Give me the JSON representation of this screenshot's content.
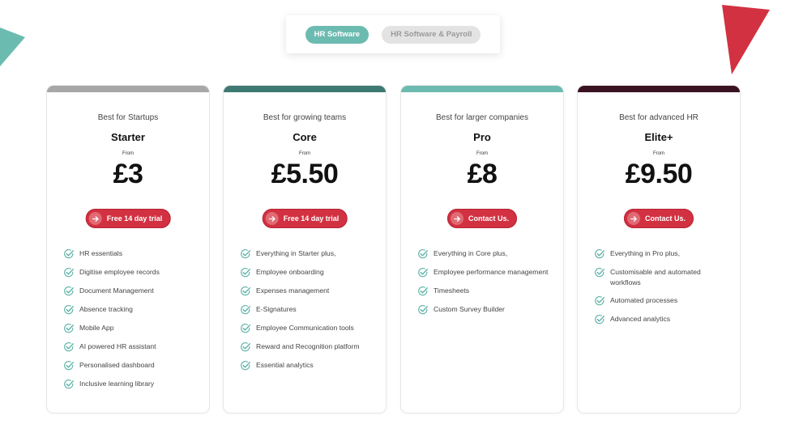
{
  "colors": {
    "teal_light": "#6cbbb1",
    "teal_dark": "#3e7a73",
    "grey_bar": "#a7a7a7",
    "maroon": "#3a1222",
    "red": "#d23141",
    "deco_red": "#d23141",
    "check": "#5bb1a7"
  },
  "toggle": {
    "options": [
      "HR Software",
      "HR Software & Payroll"
    ],
    "selected": "HR Software"
  },
  "plans": [
    {
      "subtitle": "Best for Startups",
      "name": "Starter",
      "from_label": "From",
      "price": "£3",
      "cta": "Free 14 day trial",
      "bar_color": "#a7a7a7",
      "features": [
        "HR essentials",
        "Digitise employee records",
        "Document Management",
        "Absence tracking",
        "Mobile App",
        "AI powered HR assistant",
        "Personalised dashboard",
        "Inclusive learning library"
      ]
    },
    {
      "subtitle": "Best for growing teams",
      "name": "Core",
      "from_label": "From",
      "price": "£5.50",
      "cta": "Free 14 day trial",
      "bar_color": "#3e7a73",
      "features": [
        "Everything in Starter plus,",
        "Employee onboarding",
        "Expenses management",
        "E-Signatures",
        "Employee Communication tools",
        "Reward and Recognition platform",
        "Essential analytics"
      ]
    },
    {
      "subtitle": "Best for larger companies",
      "name": "Pro",
      "from_label": "From",
      "price": "£8",
      "cta": "Contact Us.",
      "bar_color": "#6cbbb1",
      "features": [
        "Everything in Core plus,",
        "Employee performance management",
        "Timesheets",
        "Custom Survey Builder"
      ]
    },
    {
      "subtitle": "Best for advanced HR",
      "name": "Elite+",
      "from_label": "From",
      "price": "£9.50",
      "cta": "Contact Us.",
      "bar_color": "#3a1222",
      "features": [
        "Everything in Pro plus,",
        "Customisable and automated workflows",
        "Automated processes",
        "Advanced analytics"
      ]
    }
  ]
}
